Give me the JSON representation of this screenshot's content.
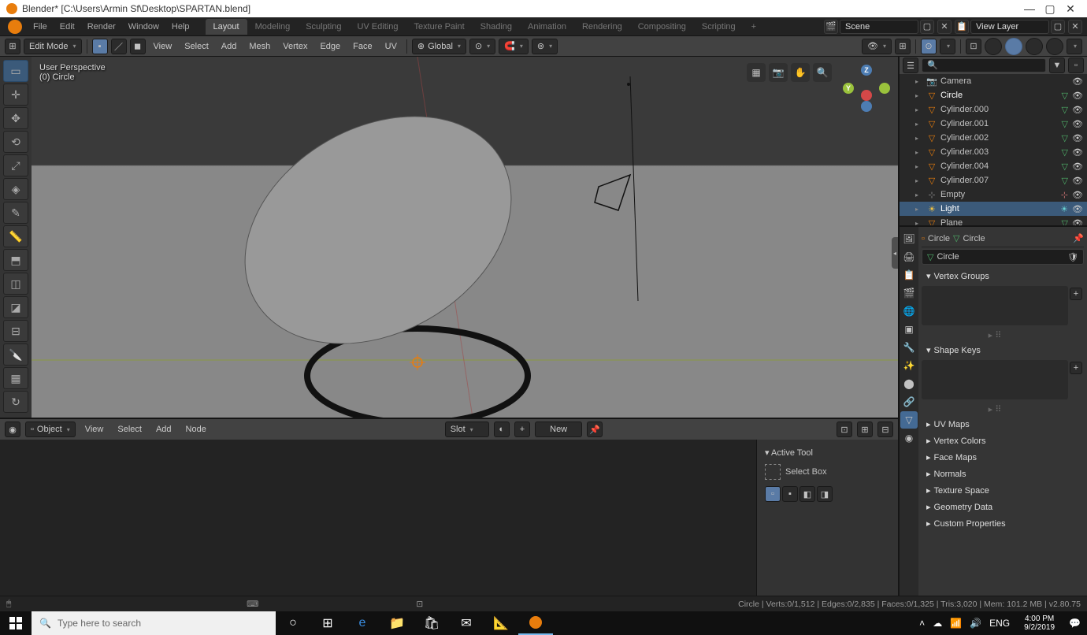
{
  "window": {
    "title": "Blender* [C:\\Users\\Armin Sf\\Desktop\\SPARTAN.blend]"
  },
  "topmenu": {
    "items": [
      "File",
      "Edit",
      "Render",
      "Window",
      "Help"
    ]
  },
  "workspaces": {
    "tabs": [
      "Layout",
      "Modeling",
      "Sculpting",
      "UV Editing",
      "Texture Paint",
      "Shading",
      "Animation",
      "Rendering",
      "Compositing",
      "Scripting"
    ],
    "active": "Layout"
  },
  "scene": {
    "label": "Scene",
    "viewlayer": "View Layer"
  },
  "header": {
    "mode": "Edit Mode",
    "menus": [
      "View",
      "Select",
      "Add",
      "Mesh",
      "Vertex",
      "Edge",
      "Face",
      "UV"
    ],
    "orientation": "Global"
  },
  "viewport": {
    "info1": "User Perspective",
    "info2": "(0) Circle"
  },
  "shader": {
    "mode": "Object",
    "menus": [
      "View",
      "Select",
      "Add",
      "Node"
    ],
    "slot": "Slot",
    "new": "New",
    "active_tool": "Active Tool",
    "tool_name": "Select Box"
  },
  "outliner": {
    "items": [
      {
        "name": "Camera",
        "icon": "cam",
        "indent": 1
      },
      {
        "name": "Circle",
        "icon": "mesh",
        "indent": 1,
        "active": true
      },
      {
        "name": "Cylinder.000",
        "icon": "mesh",
        "indent": 1
      },
      {
        "name": "Cylinder.001",
        "icon": "mesh",
        "indent": 1
      },
      {
        "name": "Cylinder.002",
        "icon": "mesh",
        "indent": 1
      },
      {
        "name": "Cylinder.003",
        "icon": "mesh",
        "indent": 1
      },
      {
        "name": "Cylinder.004",
        "icon": "mesh",
        "indent": 1
      },
      {
        "name": "Cylinder.007",
        "icon": "mesh",
        "indent": 1
      },
      {
        "name": "Empty",
        "icon": "empty",
        "indent": 1
      },
      {
        "name": "Light",
        "icon": "light",
        "indent": 1,
        "selected": true
      },
      {
        "name": "Plane",
        "icon": "mesh",
        "indent": 1
      }
    ]
  },
  "properties": {
    "breadcrumb1": "Circle",
    "breadcrumb2": "Circle",
    "object_name": "Circle",
    "panels": [
      "Vertex Groups",
      "Shape Keys",
      "UV Maps",
      "Vertex Colors",
      "Face Maps",
      "Normals",
      "Texture Space",
      "Geometry Data",
      "Custom Properties"
    ]
  },
  "statusbar": {
    "stats": "Circle | Verts:0/1,512 | Edges:0/2,835 | Faces:0/1,325 | Tris:3,020 | Mem: 101.2 MB | v2.80.75"
  },
  "taskbar": {
    "search_placeholder": "Type here to search",
    "lang": "ENG",
    "time": "4:00 PM",
    "date": "9/2/2019"
  }
}
